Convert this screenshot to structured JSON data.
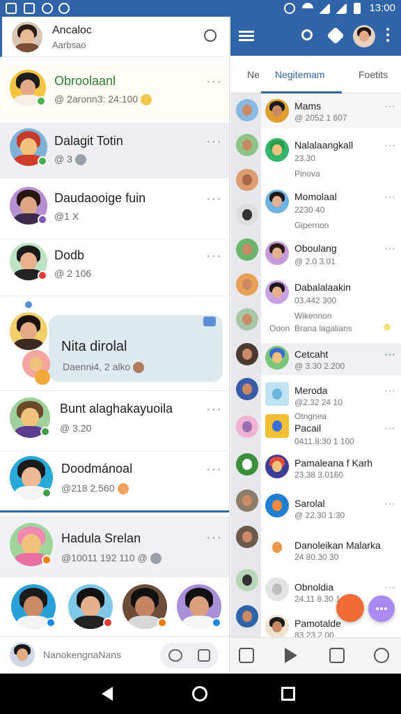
{
  "status_bar": {
    "time": "13:00"
  },
  "left": {
    "header": {
      "title": "Ancaloc",
      "subtitle": "Aarbsao"
    },
    "chats": [
      {
        "name": "Obroolaanl",
        "sub": "@ 2aronn3: 24:100",
        "name_color": "#2e7d32"
      },
      {
        "name": "Dalagit Totin",
        "sub": "@ 3"
      },
      {
        "name": "Daudaooige fuin",
        "sub": "@1 X"
      },
      {
        "name": "Dodb",
        "sub": "@ 2 106"
      },
      {
        "name": "Nita dirolal",
        "sub": "Daenni4, 2 alko"
      },
      {
        "name": "Bunt alaghakayuoila",
        "sub": "@ 3.20"
      },
      {
        "name": "Doodmánoal",
        "sub": "@218 2.560"
      },
      {
        "name": "Hadula Srelan",
        "sub": "@10011 192 110 @"
      }
    ],
    "composer_placeholder": "NanokengnaNans"
  },
  "right": {
    "tabs": [
      "Ne",
      "Negitemam",
      "Foetits"
    ],
    "chats": [
      {
        "name": "Mams",
        "sub": "@ 2052 1 607"
      },
      {
        "name": "Nalalaangkall",
        "sub": "23.30",
        "extra": "Pinova"
      },
      {
        "name": "Momolaal",
        "sub": "2230 40",
        "extra": "Gipernon"
      },
      {
        "name": "Oboulang",
        "sub": "@ 2.0 3.01"
      },
      {
        "name": "Dabalalaakin",
        "sub": "03.442 300",
        "extra": "Wikennon",
        "extra2": "Brana lagalians",
        "side": "Ooon"
      },
      {
        "name": "Cetcaht",
        "sub": "@ 3.30 2.200"
      },
      {
        "name": "Meroda",
        "sub": "@2.32 24 10"
      },
      {
        "name": "Pacail",
        "sub": "0411.8:30 1 100",
        "extra": "Otngnea"
      },
      {
        "name": "Pamaleana f Karh",
        "sub": "23.38 3.0160"
      },
      {
        "name": "Sarolal",
        "sub": "@ 22.30 1:30"
      },
      {
        "name": "Danoleikan Malarka",
        "sub": "24 80.30 30"
      },
      {
        "name": "Obnoldia",
        "sub": "24.11 8.30 1 90"
      },
      {
        "name": "Pamotalde",
        "sub": "83.23 2.00"
      }
    ]
  },
  "colors": {
    "brand": "#2f64a8",
    "fab_orange": "#f06a35",
    "fab_purple": "#a98af0"
  }
}
